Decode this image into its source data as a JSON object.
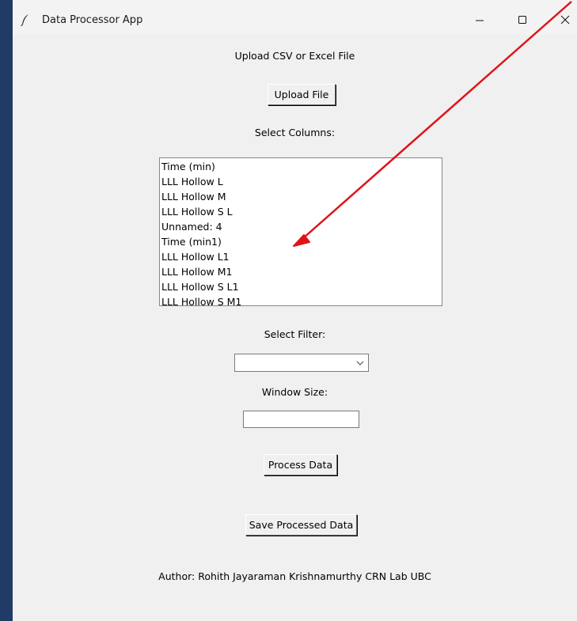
{
  "window": {
    "title": "Data Processor App"
  },
  "main": {
    "upload_label": "Upload CSV or Excel File",
    "upload_button": "Upload File",
    "columns_label": "Select Columns:",
    "columns": [
      "Time (min)",
      "LLL Hollow L",
      "LLL Hollow M",
      "LLL Hollow S L",
      "Unnamed: 4",
      "Time (min1)",
      "LLL Hollow L1",
      "LLL Hollow M1",
      "LLL Hollow S L1",
      "LLL Hollow S M1"
    ],
    "filter_label": "Select Filter:",
    "filter_value": "",
    "window_size_label": "Window Size:",
    "window_size_value": "",
    "process_button": "Process Data",
    "save_button": "Save Processed Data",
    "author": "Author: Rohith Jayaraman Krishnamurthy  CRN Lab UBC"
  },
  "annotation": {
    "arrow_color": "#e0121a"
  },
  "colors": {
    "background": "#f0f0f0",
    "taskbar_strip": "#1f3b66"
  },
  "icons": [
    "feather-icon",
    "minimize-icon",
    "maximize-icon",
    "close-icon",
    "chevron-down-icon"
  ]
}
